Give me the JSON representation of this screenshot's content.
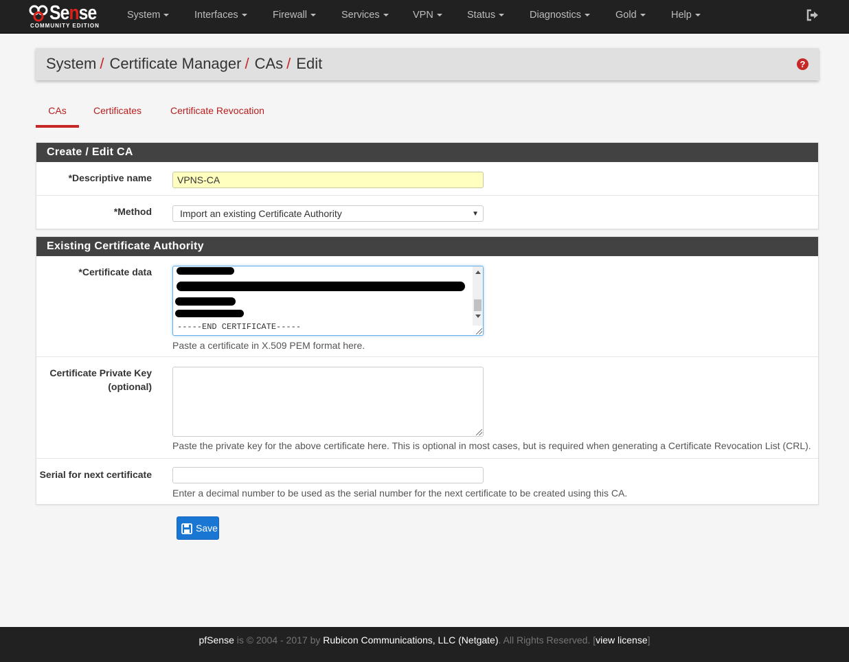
{
  "navbar": {
    "logo_text": "Sense",
    "logo_sub": "COMMUNITY EDITION",
    "menu": [
      "System",
      "Interfaces",
      "Firewall",
      "Services",
      "VPN",
      "Status",
      "Diagnostics",
      "Gold",
      "Help"
    ]
  },
  "breadcrumb": [
    "System",
    "Certificate Manager",
    "CAs",
    "Edit"
  ],
  "tabs": [
    "CAs",
    "Certificates",
    "Certificate Revocation"
  ],
  "panel1": {
    "title": "Create / Edit CA",
    "descriptive_name_label": "*Descriptive name",
    "descriptive_name_value": "VPNS-CA",
    "method_label": "*Method",
    "method_value": "Import an existing Certificate Authority"
  },
  "panel2": {
    "title": "Existing Certificate Authority",
    "cert_data_label": "*Certificate data",
    "cert_data_last_line": "-----END CERTIFICATE-----",
    "cert_data_hint": "Paste a certificate in X.509 PEM format here.",
    "private_key_label_1": "Certificate Private Key",
    "private_key_label_2": "(optional)",
    "private_key_hint": "Paste the private key for the above certificate here. This is optional in most cases, but is required when generating a Certificate Revocation List (CRL).",
    "serial_label": "Serial for next certificate",
    "serial_hint": "Enter a decimal number to be used as the serial number for the next certificate to be created using this CA."
  },
  "save_label": "Save",
  "footer": {
    "brand": "pfSense",
    "text1": "is © 2004 - 2017 by",
    "company": "Rubicon Communications, LLC (Netgate)",
    "text2": ". All Rights Reserved. [",
    "link": "view license",
    "text3": "]"
  },
  "colors": {
    "accent": "#c62828",
    "navbar": "#212121",
    "panel_header": "#424242",
    "button": "#1976d2"
  }
}
